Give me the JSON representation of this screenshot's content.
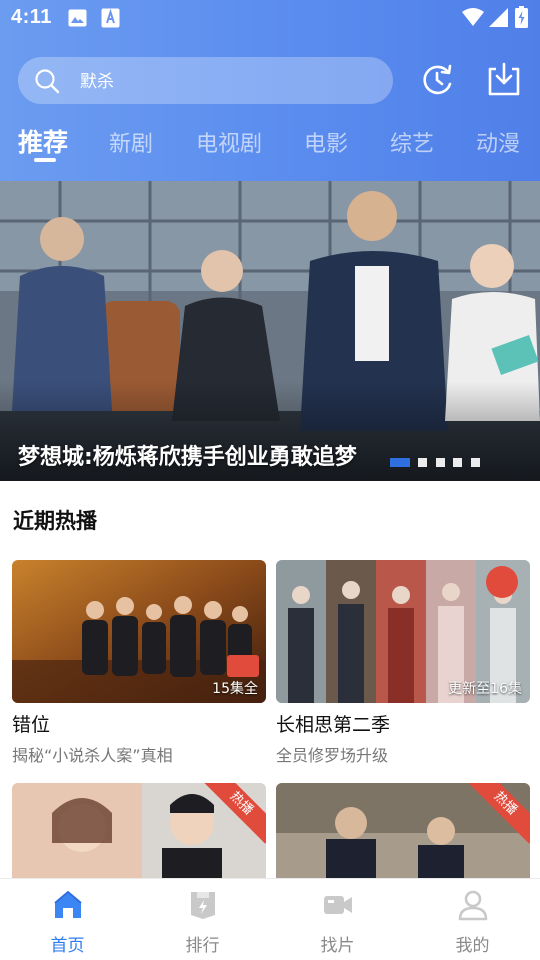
{
  "status_bar": {
    "time": "4:11"
  },
  "search": {
    "query": "默杀"
  },
  "tabs": [
    {
      "label": "推荐",
      "active": true
    },
    {
      "label": "新剧"
    },
    {
      "label": "电视剧"
    },
    {
      "label": "电影"
    },
    {
      "label": "综艺"
    },
    {
      "label": "动漫"
    }
  ],
  "banner": {
    "caption": "梦想城:杨烁蒋欣携手创业勇敢追梦",
    "slide_count": 5,
    "active_slide": 1
  },
  "section": {
    "title": "近期热播"
  },
  "cards": [
    {
      "title": "错位",
      "subtitle": "揭秘“小说杀人案”真相",
      "badge": "15集全"
    },
    {
      "title": "长相思第二季",
      "subtitle": "全员修罗场升级",
      "badge": "更新至16集"
    },
    {
      "ribbon": "热播"
    },
    {
      "ribbon": "热播"
    }
  ],
  "bottom_nav": [
    {
      "label": "首页",
      "icon": "home-icon",
      "active": true
    },
    {
      "label": "排行",
      "icon": "ranking-icon"
    },
    {
      "label": "找片",
      "icon": "video-icon"
    },
    {
      "label": "我的",
      "icon": "profile-icon"
    }
  ],
  "colors": {
    "header_gradient_start": "#6c9cf0",
    "header_gradient_end": "#4f7fe8",
    "accent": "#2f7ef0",
    "ribbon": "#e14b3c"
  }
}
